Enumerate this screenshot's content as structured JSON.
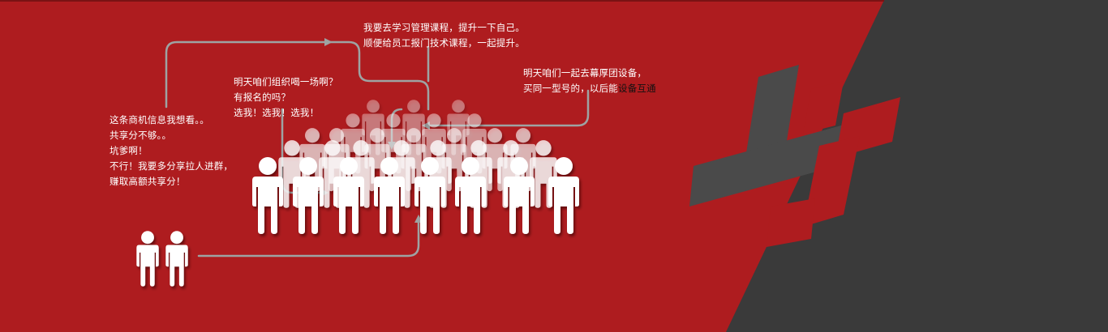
{
  "colors": {
    "background_red": "#ae1c1f",
    "panel_dark": "#3a3a3a",
    "connector_gray": "#9ea3a3",
    "figure_white": "#ffffff",
    "highlight_text": "#111111"
  },
  "notes": {
    "top": {
      "line1": "我要去学习管理课程，提升一下自己。",
      "line2": "顺便给员工报门技术课程，一起提升。"
    },
    "middle": {
      "line1": "明天咱们组织喝一场啊？",
      "line2": "有报名的吗？",
      "line3": "选我！选我！选我！"
    },
    "right": {
      "line1": "明天咱们一起去幕厚团设备，",
      "line2_prefix": "买同一型号的，以后能",
      "line2_highlight": "设备互通"
    },
    "left": {
      "line1": "这条商机信息我想看。。",
      "line2": "共享分不够。。",
      "line3": "坑爹啊！",
      "line4": "不行！我要多分享拉人进群，",
      "line5": "赚取高额共享分！"
    }
  },
  "icons": {
    "crowd": "people-crowd-icon",
    "pair": "two-people-icon",
    "emblem": "stylized-character-emblem"
  }
}
